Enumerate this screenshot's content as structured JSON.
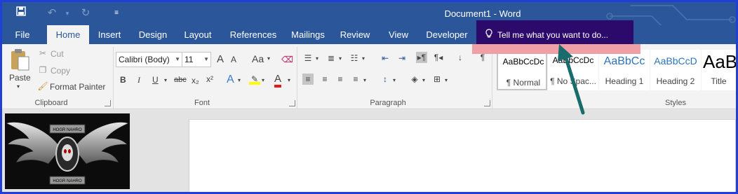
{
  "titlebar": {
    "title": "Document1 - Word",
    "save_icon": "save-icon",
    "undo_icon": "undo-icon",
    "redo_icon": "redo-icon",
    "customize_icon": "customize-qat-icon"
  },
  "tabs": [
    "File",
    "Home",
    "Insert",
    "Design",
    "Layout",
    "References",
    "Mailings",
    "Review",
    "View",
    "Developer"
  ],
  "active_tab": "Home",
  "tell_me": {
    "text": "Tell me what you want to do...",
    "icon": "lightbulb-icon"
  },
  "clipboard": {
    "paste": "Paste",
    "cut": "Cut",
    "copy": "Copy",
    "format_painter": "Format Painter",
    "label": "Clipboard"
  },
  "font": {
    "name": "Calibri (Body)",
    "size": "11",
    "grow": "A",
    "shrink": "A",
    "case": "Aa",
    "bold": "B",
    "italic": "I",
    "underline": "U",
    "strike": "abc",
    "subscript": "x₂",
    "superscript": "x²",
    "label": "Font"
  },
  "paragraph": {
    "label": "Paragraph"
  },
  "styles": {
    "label": "Styles",
    "items": [
      {
        "sample": "AaBbCcDc",
        "name": "¶ Normal"
      },
      {
        "sample": "AaBbCcDc",
        "name": "¶ No Spac..."
      },
      {
        "sample": "AaBbCc",
        "name": "Heading 1"
      },
      {
        "sample": "AaBbCcD",
        "name": "Heading 2"
      },
      {
        "sample": "AaB",
        "name": "Title"
      }
    ]
  },
  "logo": {
    "top_text": "HOGR NAHRO",
    "bottom_text": "HOGR NAHRO"
  },
  "colors": {
    "accent": "#2b579a",
    "tellme_bg": "#2c0a6b",
    "tellme_highlight": "#efa0a6",
    "arrow": "#1a6b6b",
    "border": "#1f3fd6"
  }
}
